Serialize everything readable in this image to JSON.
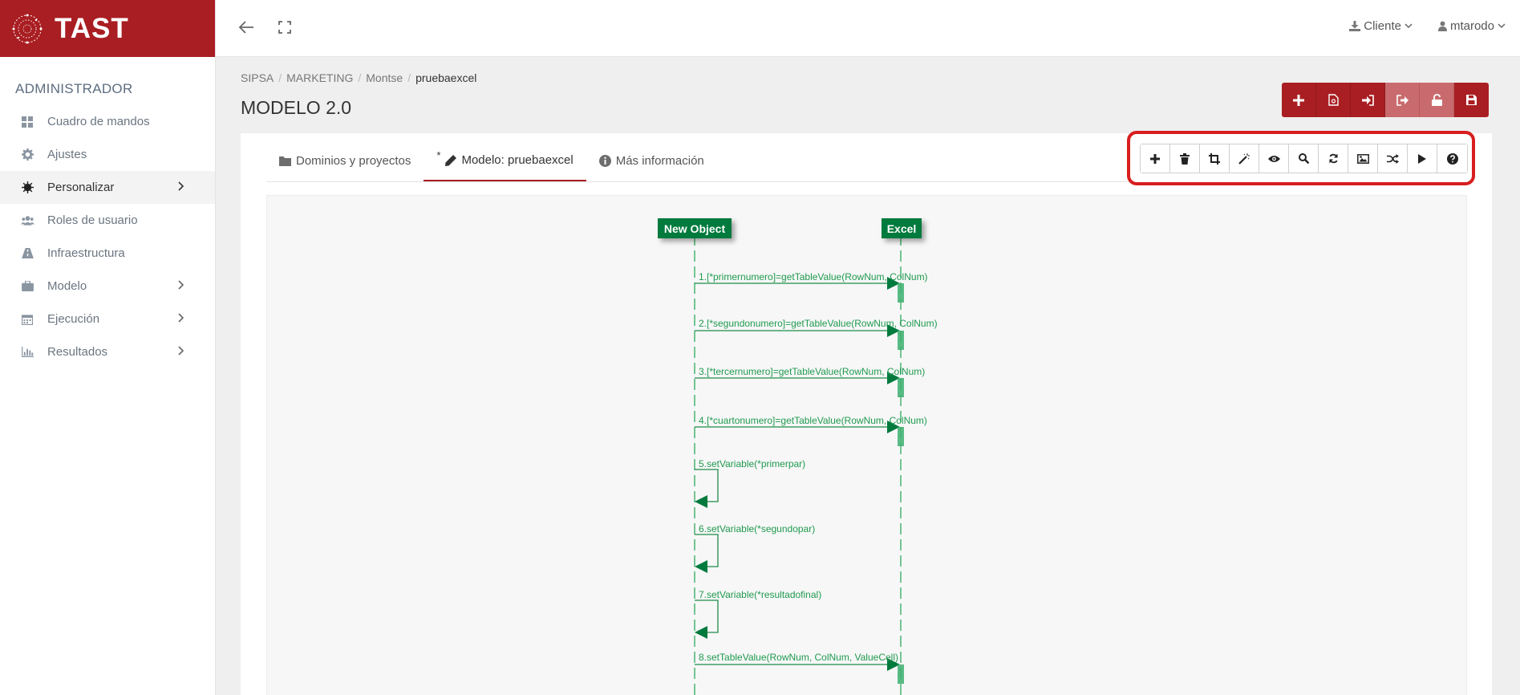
{
  "brand": {
    "name": "TAST"
  },
  "sidebar": {
    "role": "ADMINISTRADOR",
    "items": [
      {
        "label": "Cuadro de mandos",
        "icon": "dashboard-icon"
      },
      {
        "label": "Ajustes",
        "icon": "gear-icon"
      },
      {
        "label": "Personalizar",
        "icon": "sun-icon"
      },
      {
        "label": "Roles de usuario",
        "icon": "users-icon"
      },
      {
        "label": "Infraestructura",
        "icon": "road-icon"
      },
      {
        "label": "Modelo",
        "icon": "briefcase-icon"
      },
      {
        "label": "Ejecución",
        "icon": "calendar-icon"
      },
      {
        "label": "Resultados",
        "icon": "bar-chart-icon"
      }
    ]
  },
  "topbar": {
    "client_label": "Cliente",
    "user_label": "mtarodo"
  },
  "breadcrumb": [
    "SIPSA",
    "MARKETING",
    "Montse",
    "pruebaexcel"
  ],
  "page": {
    "title": "MODELO 2.0"
  },
  "tabs": [
    {
      "label": "Dominios y proyectos",
      "icon": "folder-icon"
    },
    {
      "label": "Modelo: pruebaexcel",
      "icon": "pencil-icon",
      "prefix": "*"
    },
    {
      "label": "Más información",
      "icon": "info-icon"
    }
  ],
  "diagram": {
    "objects": [
      "New Object",
      "Excel"
    ],
    "messages": [
      "1.[*primernumero]=getTableValue(RowNum, ColNum)",
      "2.[*segundonumero]=getTableValue(RowNum, ColNum)",
      "3.[*tercernumero]=getTableValue(RowNum, ColNum)",
      "4.[*cuartonumero]=getTableValue(RowNum, ColNum)",
      "5.setVariable(*primerpar)",
      "6.setVariable(*segundopar)",
      "7.setVariable(*resultadofinal)",
      "8.setTableValue(RowNum, ColNum, ValueCell)"
    ]
  },
  "colors": {
    "brand": "#a91e22",
    "diagram_green": "#007a3d",
    "highlight": "#d81e1e"
  }
}
